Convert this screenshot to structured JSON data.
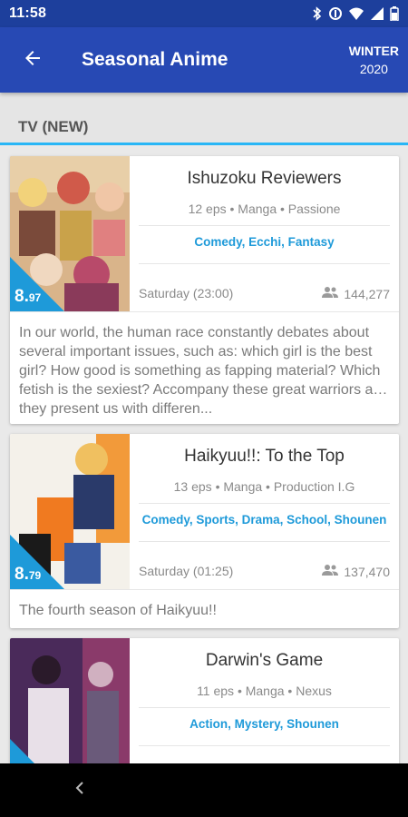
{
  "status_bar": {
    "time": "11:58"
  },
  "app_bar": {
    "title": "Seasonal Anime",
    "season_name": "WINTER",
    "season_year": "2020"
  },
  "section": {
    "title": "TV (NEW)"
  },
  "cards": [
    {
      "title": "Ishuzoku Reviewers",
      "meta": "12 eps • Manga • Passione",
      "genres": "Comedy, Ecchi, Fantasy",
      "airing": "Saturday (23:00)",
      "members": "144,277",
      "score_main": "8.",
      "score_decimal": "97",
      "synopsis": "In our world, the human race constantly debates about several important issues, such as: which girl is the best girl? How good is something as fapping material? Which fetish is the sexiest? Accompany these great warriors as they present us with differen..."
    },
    {
      "title": "Haikyuu!!: To the Top",
      "meta": "13 eps • Manga • Production I.G",
      "genres": "Comedy, Sports, Drama, School, Shounen",
      "airing": "Saturday (01:25)",
      "members": "137,470",
      "score_main": "8.",
      "score_decimal": "79",
      "synopsis": "The fourth season of Haikyuu!!"
    },
    {
      "title": "Darwin's Game",
      "meta": "11 eps • Manga • Nexus",
      "genres": "Action, Mystery, Shounen"
    }
  ],
  "colors": {
    "status_bar": "#1d3f9c",
    "app_bar": "#2749b4",
    "accent": "#1e9ad9",
    "section_line": "#29b6f6"
  }
}
